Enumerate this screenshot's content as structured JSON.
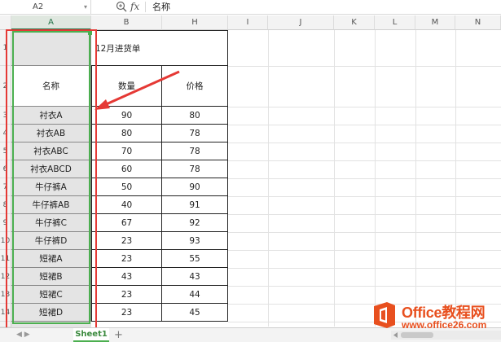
{
  "formula_bar": {
    "name_box": "A2",
    "fx": "fx",
    "content": "名称"
  },
  "columns": [
    "A",
    "B",
    "H",
    "I",
    "J",
    "K",
    "L",
    "M",
    "N"
  ],
  "rows": [
    "1",
    "2",
    "3",
    "4",
    "5",
    "6",
    "7",
    "8",
    "9",
    "10",
    "11",
    "12",
    "13",
    "14"
  ],
  "table": {
    "title": "12月进货单",
    "headers": {
      "name": "名称",
      "qty": "数量",
      "price": "价格"
    },
    "data": [
      {
        "name": "衬衣A",
        "qty": "90",
        "price": "80"
      },
      {
        "name": "衬衣AB",
        "qty": "80",
        "price": "78"
      },
      {
        "name": "衬衣ABC",
        "qty": "70",
        "price": "78"
      },
      {
        "name": "衬衣ABCD",
        "qty": "60",
        "price": "78"
      },
      {
        "name": "牛仔裤A",
        "qty": "50",
        "price": "90"
      },
      {
        "name": "牛仔裤AB",
        "qty": "40",
        "price": "91"
      },
      {
        "name": "牛仔裤C",
        "qty": "67",
        "price": "92"
      },
      {
        "name": "牛仔裤D",
        "qty": "23",
        "price": "93"
      },
      {
        "name": "短裙A",
        "qty": "23",
        "price": "55"
      },
      {
        "name": "短裙B",
        "qty": "43",
        "price": "43"
      },
      {
        "name": "短裙C",
        "qty": "23",
        "price": "44"
      },
      {
        "name": "短裙D",
        "qty": "23",
        "price": "45"
      }
    ]
  },
  "sheet_bar": {
    "active_sheet": "Sheet1",
    "add_label": "+"
  },
  "watermark": {
    "brand": "Office教程网",
    "url": "www.office26.com"
  },
  "colors": {
    "selection_green": "#4caf50",
    "annotation_red": "#e53935",
    "brand_orange": "#e8501f"
  }
}
